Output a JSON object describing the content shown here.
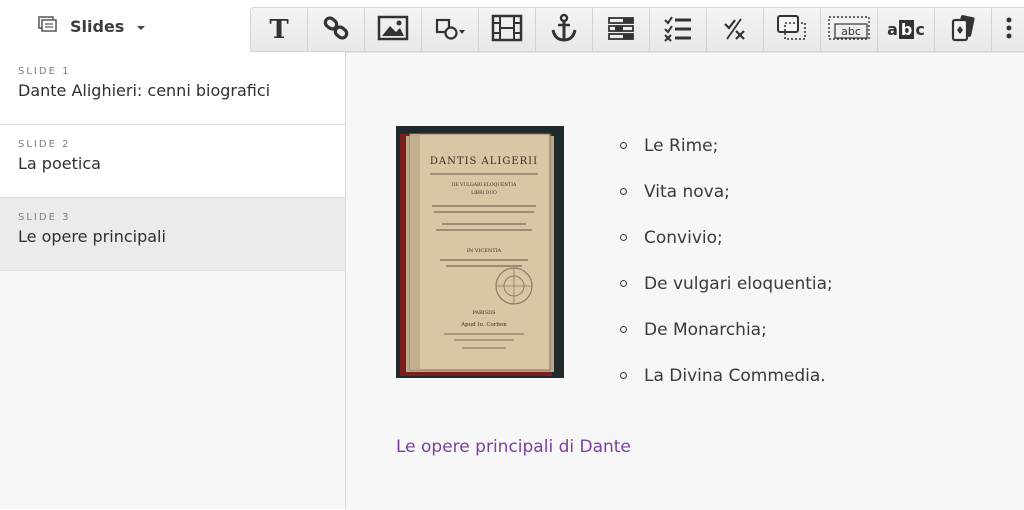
{
  "header": {
    "slides_label": "Slides",
    "icons": [
      "slides-list-icon",
      "dropdown-caret-icon"
    ]
  },
  "toolbar": {
    "tools": [
      "text-icon",
      "link-icon",
      "image-icon",
      "shapes-icon",
      "video-icon",
      "anchor-icon",
      "form-icon",
      "checklist-icon",
      "dismiss-icon",
      "frame-icon",
      "textbox-icon",
      "spellcheck-icon",
      "cards-icon",
      "more-icon"
    ],
    "textbox_label": "abc",
    "spell_a": "a",
    "spell_b": "b",
    "spell_c": "c",
    "text_glyph": "T"
  },
  "sidebar": {
    "items": [
      {
        "num": "SLIDE 1",
        "title": "Dante Alighieri: cenni biografici"
      },
      {
        "num": "SLIDE 2",
        "title": "La poetica"
      },
      {
        "num": "SLIDE 3",
        "title": "Le opere principali"
      }
    ],
    "active_index": 2
  },
  "slide": {
    "bullets": [
      "Le Rime;",
      "Vita nova;",
      "Convivio;",
      "De vulgari eloquentia;",
      "De Monarchia;",
      "La Divina Commedia."
    ],
    "caption": "Le opere principali di Dante",
    "book_title_page": {
      "line1": "DANTIS ALIGERII",
      "line2": "DE VULGARI ELOQUENTIA",
      "line3": "LIBRI DUO",
      "line4": "IN VICENTIA",
      "line5": "PARISIIS",
      "line6": "Apud Io. Corbon"
    }
  },
  "colors": {
    "caption": "#7b3fa0",
    "active_item": "#ebebeb",
    "toolbar": "#eeeeee"
  }
}
